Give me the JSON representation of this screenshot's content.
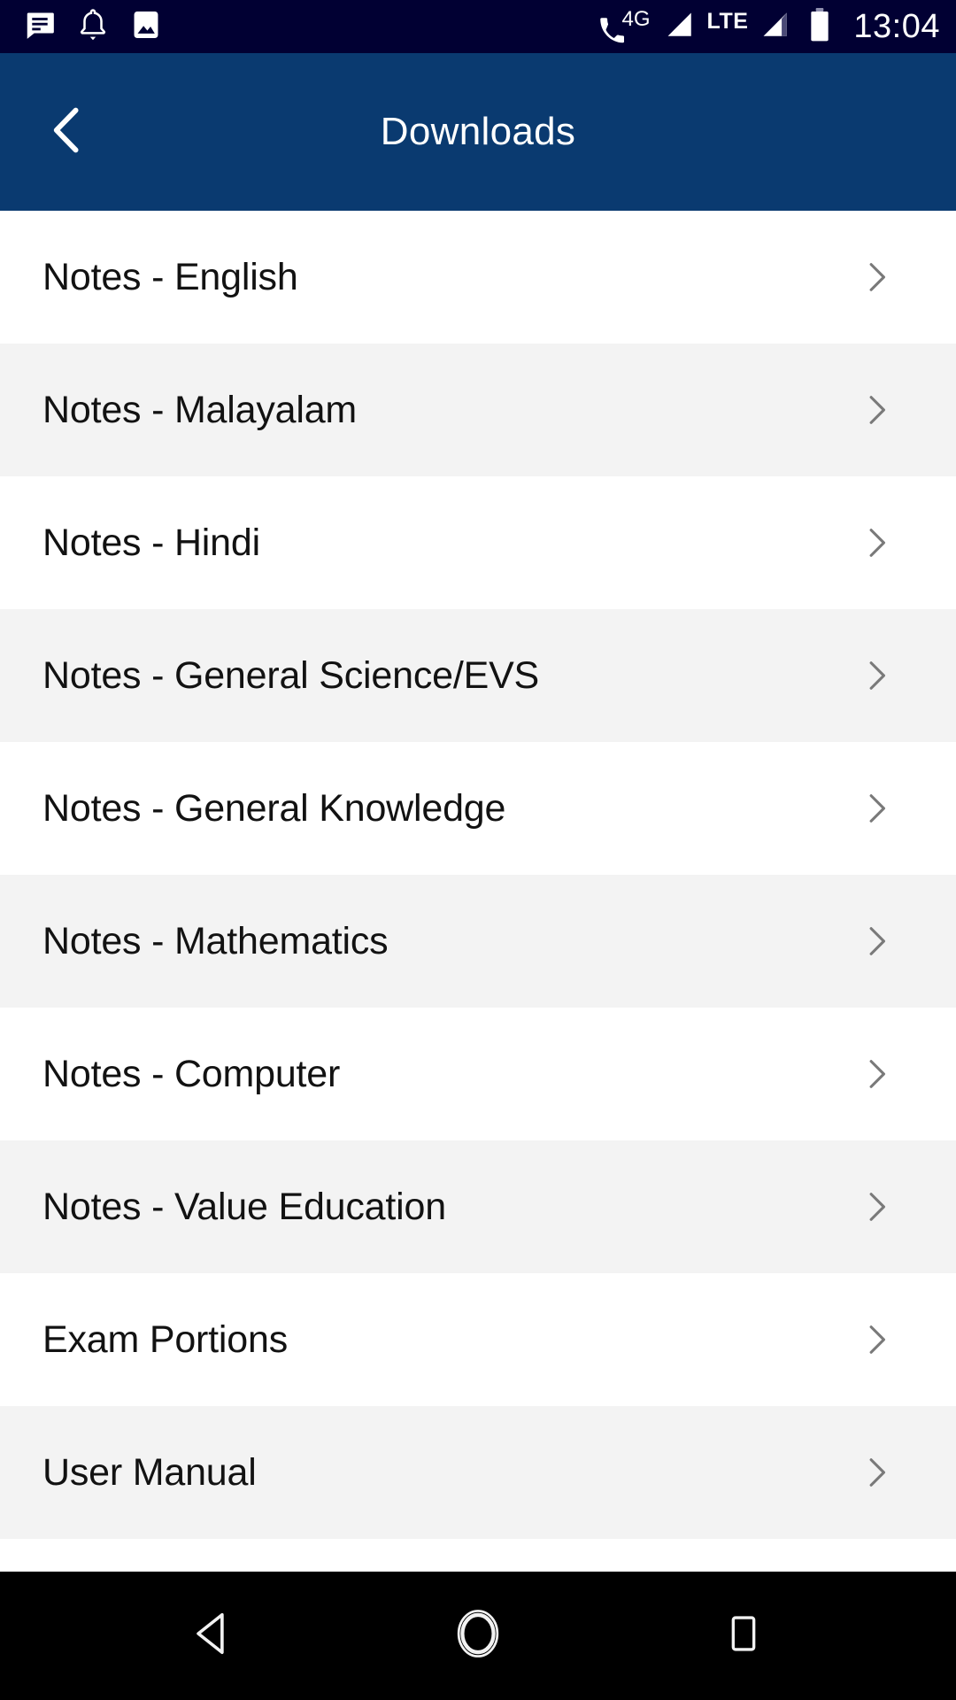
{
  "statusbar": {
    "left_icons": [
      {
        "name": "message-icon",
        "label": "Messages"
      },
      {
        "name": "bell-icon",
        "label": "Notification"
      },
      {
        "name": "image-icon",
        "label": "Screenshot"
      }
    ],
    "network_label": "4G",
    "lte_label": "LTE",
    "right_icons": [
      {
        "name": "phone-call-icon",
        "label": "Call"
      },
      {
        "name": "signal-bars-icon-1",
        "label": "Signal SIM1"
      },
      {
        "name": "signal-bars-icon-2",
        "label": "Signal SIM2"
      },
      {
        "name": "battery-icon",
        "label": "Battery full"
      }
    ],
    "clock": "13:04",
    "background_color": "#010033",
    "foreground_color": "#FFFFFF"
  },
  "header": {
    "title": "Downloads",
    "back_icon": "chevron-left-icon",
    "background_color": "#0A3A70",
    "text_color": "#FFFFFF"
  },
  "list": {
    "row_chevron_icon": "chevron-right-icon",
    "row_bg_odd": "#FFFFFF",
    "row_bg_even": "#F3F3F3",
    "text_color": "#121212",
    "chevron_color": "#7A7A7A",
    "items": [
      {
        "label": "Notes - English"
      },
      {
        "label": "Notes - Malayalam"
      },
      {
        "label": "Notes - Hindi"
      },
      {
        "label": "Notes - General Science/EVS"
      },
      {
        "label": "Notes - General Knowledge"
      },
      {
        "label": "Notes - Mathematics"
      },
      {
        "label": "Notes - Computer"
      },
      {
        "label": "Notes - Value Education"
      },
      {
        "label": "Exam Portions"
      },
      {
        "label": "User Manual"
      }
    ]
  },
  "navbar": {
    "background_color": "#000000",
    "buttons": [
      {
        "name": "nav-back-button",
        "icon": "triangle-left-icon",
        "label": "Back"
      },
      {
        "name": "nav-home-button",
        "icon": "circle-icon",
        "label": "Home"
      },
      {
        "name": "nav-recents-button",
        "icon": "square-icon",
        "label": "Recent apps"
      }
    ]
  }
}
